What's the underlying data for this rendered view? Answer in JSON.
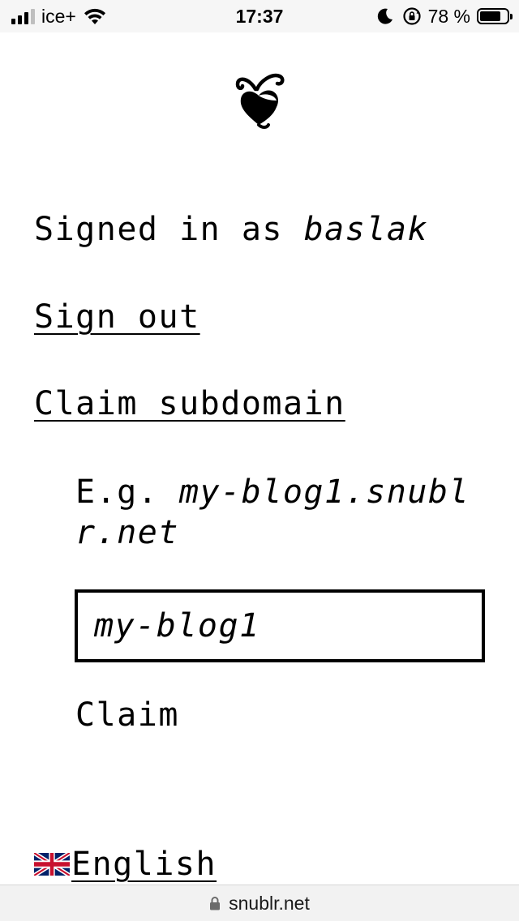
{
  "status_bar": {
    "carrier": "ice+",
    "time": "17:37",
    "battery_percent": "78 %",
    "battery_level": 0.78,
    "icons": [
      "signal-icon",
      "wifi-icon",
      "moon-icon",
      "orientation-lock-icon",
      "battery-icon"
    ]
  },
  "page": {
    "logo_icon": "snublr-logo-icon",
    "signed_in_prefix": "Signed in as",
    "username": "baslak",
    "sign_out_label": "Sign out",
    "claim_subdomain_label": "Claim subdomain",
    "example_prefix": "E.g.",
    "example_domain": "my-blog1.snublr.net",
    "subdomain_placeholder": "my-blog1",
    "claim_button_label": "Claim",
    "language_flag_icon": "uk-flag-icon",
    "language_label": "English"
  },
  "url_bar": {
    "domain": "snublr.net",
    "lock_icon": "padlock-icon"
  }
}
